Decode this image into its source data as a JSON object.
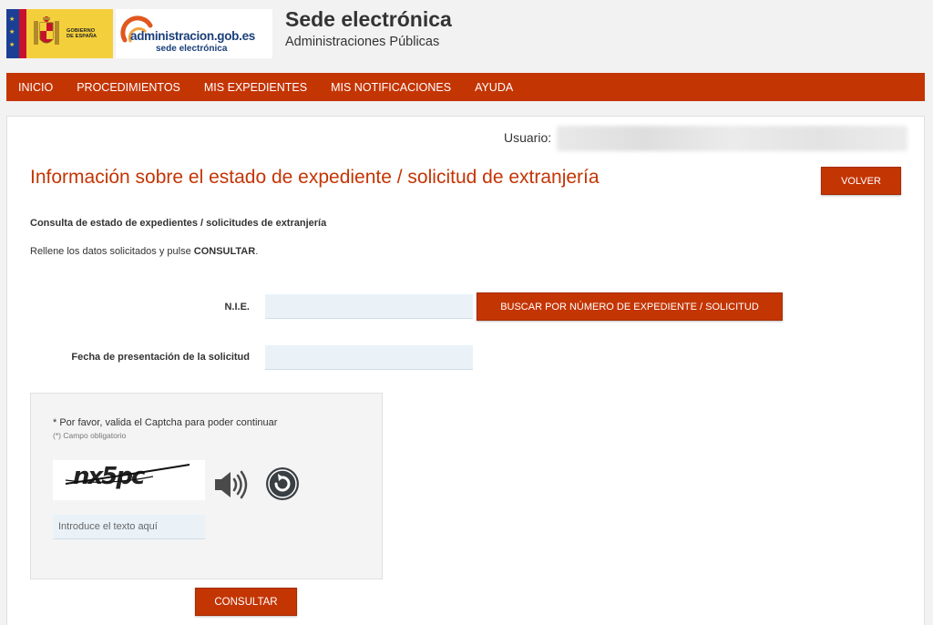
{
  "header": {
    "gob_logo_text": [
      "GOBIERNO",
      "DE ESPAÑA"
    ],
    "adm_logo_main": "administracion.gob.es",
    "adm_logo_sub": "sede electrónica",
    "title": "Sede electrónica",
    "subtitle": "Administraciones Públicas"
  },
  "nav": {
    "items": [
      "INICIO",
      "PROCEDIMIENTOS",
      "MIS EXPEDIENTES",
      "MIS NOTIFICACIONES",
      "AYUDA"
    ]
  },
  "user": {
    "label": "Usuario:"
  },
  "page": {
    "title": "Información sobre el estado de expediente / solicitud de extranjería",
    "back_button": "VOLVER",
    "section_heading": "Consulta de estado de expedientes / solicitudes de extranjería",
    "instructions_prefix": "Rellene los datos solicitados y pulse ",
    "instructions_bold": "CONSULTAR",
    "instructions_suffix": "."
  },
  "form": {
    "nie_label": "N.I.E.",
    "nie_value": "",
    "search_button": "BUSCAR POR NÚMERO DE EXPEDIENTE / SOLICITUD",
    "fecha_label": "Fecha de presentación de la solicitud",
    "fecha_value": "",
    "submit_button": "CONSULTAR"
  },
  "captcha": {
    "note": "* Por favor, valida el Captcha para poder continuar",
    "required_note": "(*) Campo obligatorio",
    "image_text": "nx5pc",
    "input_placeholder": "Introduce el texto aquí",
    "audio_icon": "speaker-icon",
    "refresh_icon": "refresh-icon"
  },
  "colors": {
    "accent": "#c43504",
    "input_bg": "#eaf2f8",
    "page_bg": "#f2f2f2"
  }
}
